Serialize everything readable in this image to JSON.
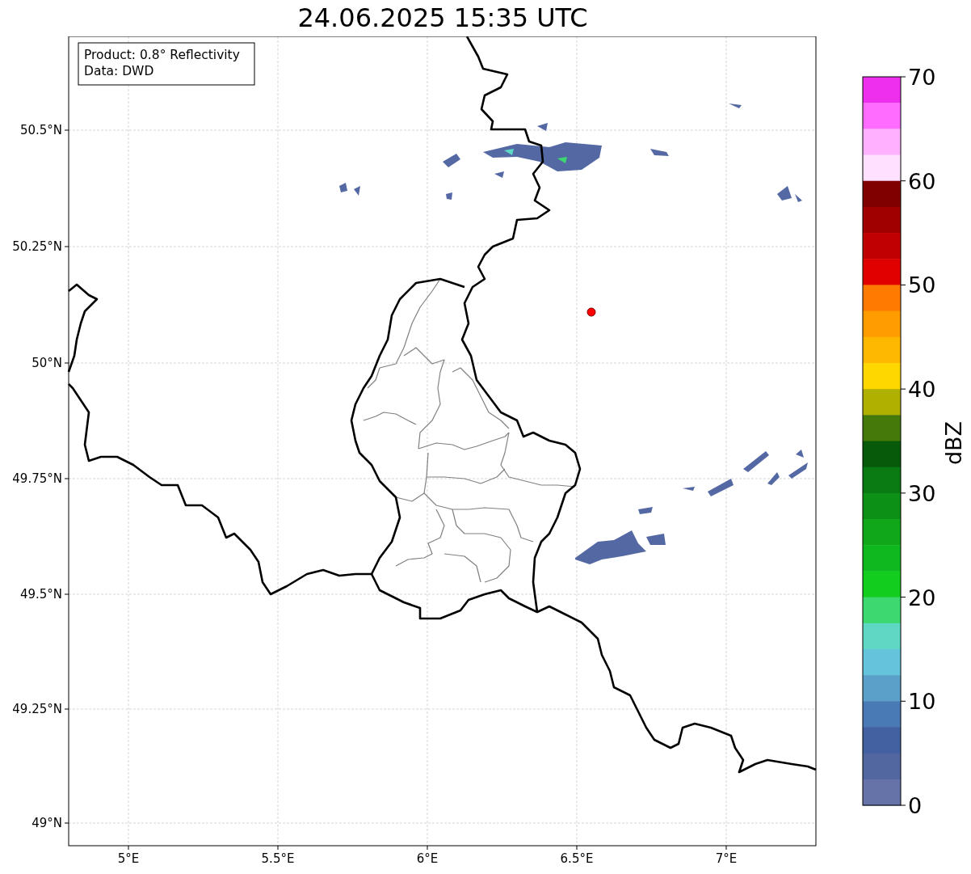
{
  "title": "24.06.2025 15:35 UTC",
  "info_box": {
    "lines": [
      "Product: 0.8° Reflectivity",
      "Data: DWD"
    ]
  },
  "map": {
    "x_ticks": [
      "5°E",
      "5.5°E",
      "6°E",
      "6.5°E",
      "7°E"
    ],
    "y_ticks": [
      "50.5°N",
      "50.25°N",
      "50°N",
      "49.75°N",
      "49.5°N",
      "49.25°N",
      "49°N"
    ]
  },
  "colorbar": {
    "label": "dBZ",
    "ticks": [
      "70",
      "60",
      "50",
      "40",
      "30",
      "20",
      "10",
      "0"
    ],
    "segments": [
      {
        "color": "#ee30ee"
      },
      {
        "color": "#ff6cff"
      },
      {
        "color": "#ffb0ff"
      },
      {
        "color": "#ffe0ff"
      },
      {
        "color": "#800000"
      },
      {
        "color": "#a00000"
      },
      {
        "color": "#c00000"
      },
      {
        "color": "#e00000"
      },
      {
        "color": "#ff7a00"
      },
      {
        "color": "#ff9c00"
      },
      {
        "color": "#ffb800"
      },
      {
        "color": "#ffd700"
      },
      {
        "color": "#b0b000"
      },
      {
        "color": "#457a0a"
      },
      {
        "color": "#065a0a"
      },
      {
        "color": "#0a7a12"
      },
      {
        "color": "#0d9016"
      },
      {
        "color": "#10a81a"
      },
      {
        "color": "#10b820"
      },
      {
        "color": "#12cc1e"
      },
      {
        "color": "#3dd970"
      },
      {
        "color": "#5ed8c4"
      },
      {
        "color": "#64c4dc"
      },
      {
        "color": "#5aa0c8"
      },
      {
        "color": "#4a7ab5"
      },
      {
        "color": "#4360a0"
      },
      {
        "color": "#5266a0"
      },
      {
        "color": "#6673a8"
      }
    ]
  }
}
